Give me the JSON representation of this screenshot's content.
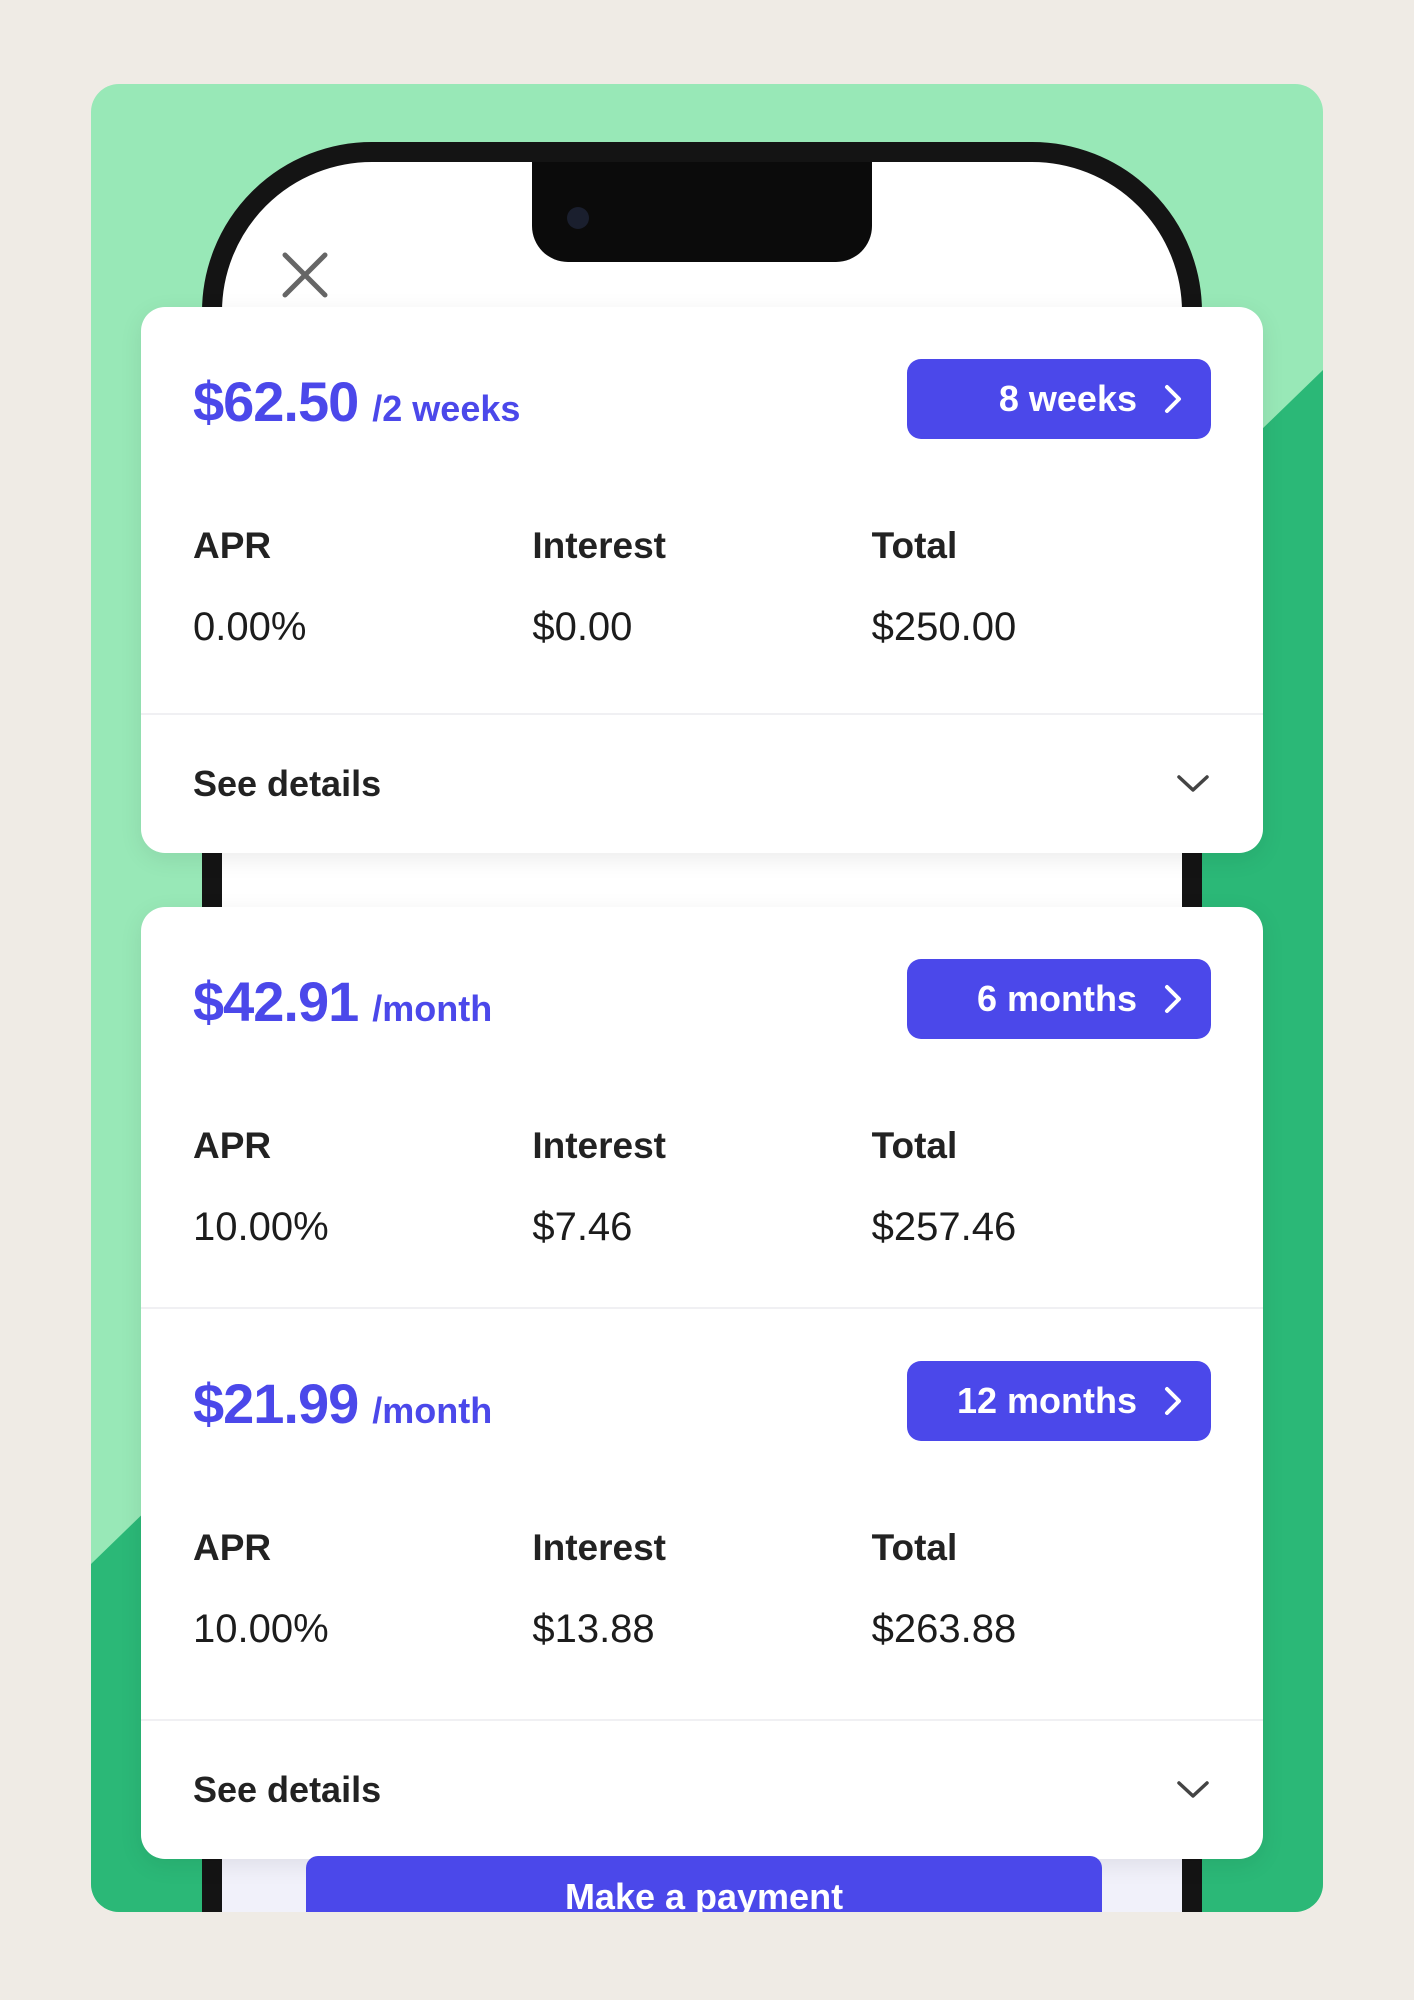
{
  "close": {
    "icon": "close-icon"
  },
  "plans": [
    {
      "price": "$62.50",
      "period": "/2 weeks",
      "term": "8 weeks",
      "apr_label": "APR",
      "apr_value": "0.00%",
      "interest_label": "Interest",
      "interest_value": "$0.00",
      "total_label": "Total",
      "total_value": "$250.00"
    },
    {
      "price": "$42.91",
      "period": "/month",
      "term": "6 months",
      "apr_label": "APR",
      "apr_value": "10.00%",
      "interest_label": "Interest",
      "interest_value": "$7.46",
      "total_label": "Total",
      "total_value": "$257.46"
    },
    {
      "price": "$21.99",
      "period": "/month",
      "term": "12 months",
      "apr_label": "APR",
      "apr_value": "10.00%",
      "interest_label": "Interest",
      "interest_value": "$13.88",
      "total_label": "Total",
      "total_value": "$263.88"
    }
  ],
  "details_label": "See details",
  "pay_button": "Make a payment",
  "colors": {
    "accent": "#4b48ea",
    "green_light": "#98e8b7",
    "green_dark": "#2bb877",
    "background": "#efebe5"
  }
}
